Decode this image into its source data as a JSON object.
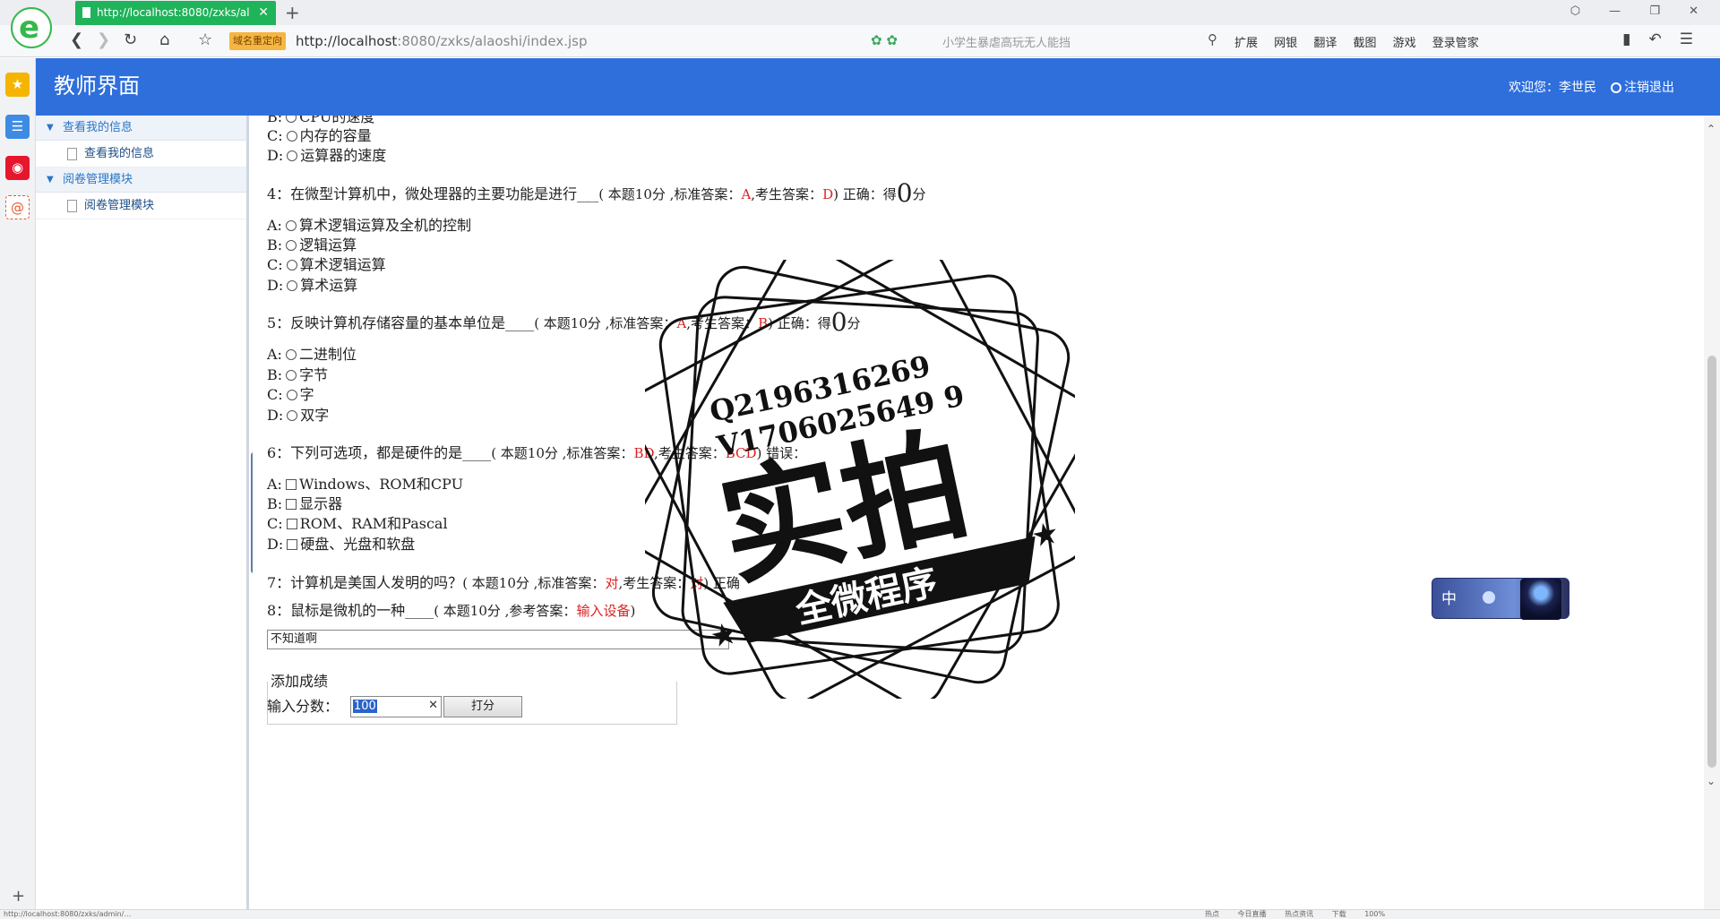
{
  "browser": {
    "tab_title": "http://localhost:8080/zxks/ala",
    "tab_close": "✕",
    "new_tab": "+",
    "window_controls": "⬡ — ❐ ✕",
    "redirect_badge": "域名重定向",
    "url_host": "http://localhost",
    "url_path": ":8080/zxks/alaoshi/index.jsp",
    "search_suggestion": "小学生暴虐高玩无人能挡",
    "extensions": [
      "扩展",
      "网银",
      "翻译",
      "截图",
      "游戏",
      "登录管家"
    ],
    "status_url": "http://localhost:8080/zxks/admin/…",
    "status_items": [
      "热点",
      "今日直播",
      "热点资讯",
      "下载",
      "100%"
    ]
  },
  "header": {
    "title": "教师界面",
    "welcome": "欢迎您：李世民",
    "logout": "注销退出"
  },
  "menu": {
    "groups": [
      {
        "label": "查看我的信息",
        "items": [
          "查看我的信息"
        ]
      },
      {
        "label": "阅卷管理模块",
        "items": [
          "阅卷管理模块"
        ]
      }
    ]
  },
  "exam": {
    "q3": {
      "options": [
        {
          "letter": "B:",
          "text": "CPU的速度"
        },
        {
          "letter": "C:",
          "text": "内存的容量"
        },
        {
          "letter": "D:",
          "text": "运算器的速度"
        }
      ]
    },
    "q4": {
      "stem": "4：在微型计算机中，微处理器的主要功能是进行___",
      "meta_open": "( 本题10分 ,标准答案：",
      "std_answer": "A",
      "meta_mid": ",考生答案：",
      "stu_answer": "D",
      "meta_close": ") 正确：得",
      "score": "0",
      "unit": "分",
      "options": [
        {
          "letter": "A:",
          "text": "算术逻辑运算及全机的控制"
        },
        {
          "letter": "B:",
          "text": "逻辑运算"
        },
        {
          "letter": "C:",
          "text": "算术逻辑运算"
        },
        {
          "letter": "D:",
          "text": "算术运算"
        }
      ]
    },
    "q5": {
      "stem": "5：反映计算机存储容量的基本单位是____",
      "meta_open": "( 本题10分 ,标准答案：",
      "std_answer": "A",
      "meta_mid": ",考生答案：",
      "stu_answer": "B",
      "meta_close": ") 正确：得",
      "score": "0",
      "unit": "分",
      "options": [
        {
          "letter": "A:",
          "text": "二进制位"
        },
        {
          "letter": "B:",
          "text": "字节"
        },
        {
          "letter": "C:",
          "text": "字"
        },
        {
          "letter": "D:",
          "text": "双字"
        }
      ]
    },
    "q6": {
      "stem": "6：下列可选项，都是硬件的是____",
      "meta_open": "( 本题10分 ,标准答案：",
      "std_answer": "BD",
      "meta_mid": ",考生答案：",
      "stu_answer": "BCD",
      "meta_close": ") 错误：",
      "options": [
        {
          "letter": "A:",
          "text": "Windows、ROM和CPU"
        },
        {
          "letter": "B:",
          "text": "显示器"
        },
        {
          "letter": "C:",
          "text": "ROM、RAM和Pascal"
        },
        {
          "letter": "D:",
          "text": "硬盘、光盘和软盘"
        }
      ]
    },
    "q7": {
      "stem": "7：计算机是美国人发明的吗？",
      "meta_open": "( 本题10分 ,标准答案：",
      "std_answer": "对",
      "meta_mid": ",考生答案：",
      "stu_answer": "对",
      "meta_close": ") 正确"
    },
    "q8": {
      "stem": "8：鼠标是微机的一种____",
      "meta_open": "( 本题10分 ,参考答案：",
      "ref_answer": "输入设备",
      "meta_close": ")",
      "student_text": "不知道啊"
    }
  },
  "grading": {
    "legend": "添加成绩",
    "label": "输入分数：",
    "value": "100",
    "button": "打分"
  },
  "overlays": {
    "ime_label": "中",
    "watermark_line1": "Q2196316269",
    "watermark_line2": "V1706025649 9",
    "watermark_main": "实拍",
    "watermark_banner": "全微程序"
  }
}
